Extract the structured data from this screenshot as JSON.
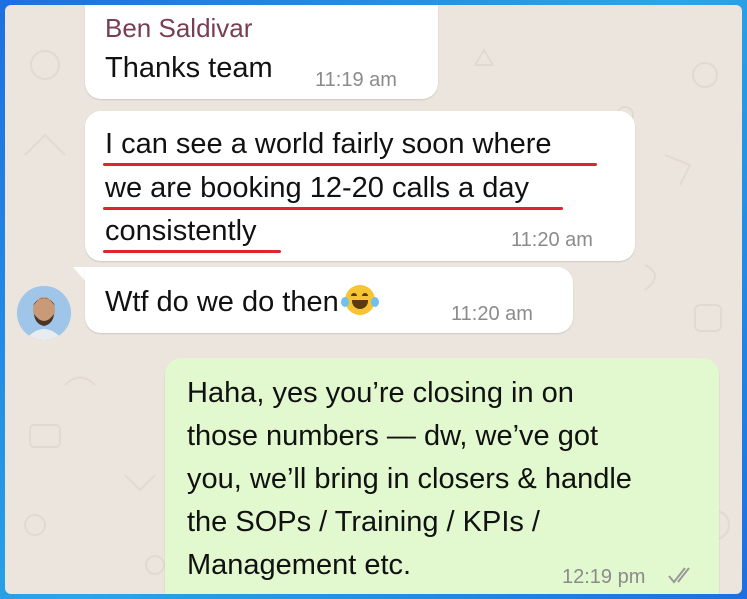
{
  "messages": [
    {
      "sender": "Ben Saldivar",
      "text": "Thanks team",
      "time": "11:19 am"
    },
    {
      "lines": [
        "I can see a world fairly soon where",
        "we are booking 12-20 calls a day",
        "consistently"
      ],
      "time": "11:20 am"
    },
    {
      "text": "Wtf do we do then",
      "emoji": "face-with-tears-of-joy",
      "time": "11:20 am"
    },
    {
      "lines": [
        "Haha, yes you’re closing in on",
        "those numbers — dw, we’ve got",
        "you, we’ll bring in closers & handle",
        "the SOPs / Training / KPIs /",
        "Management etc."
      ],
      "time": "12:19 pm",
      "status": "read-double-check"
    }
  ],
  "colors": {
    "frame": "#1e6fe0",
    "wallpaper": "#ece5dd",
    "incoming": "#ffffff",
    "outgoing": "#e2f8cf",
    "sender": "#7a3e52",
    "underline": "#e0242b"
  }
}
